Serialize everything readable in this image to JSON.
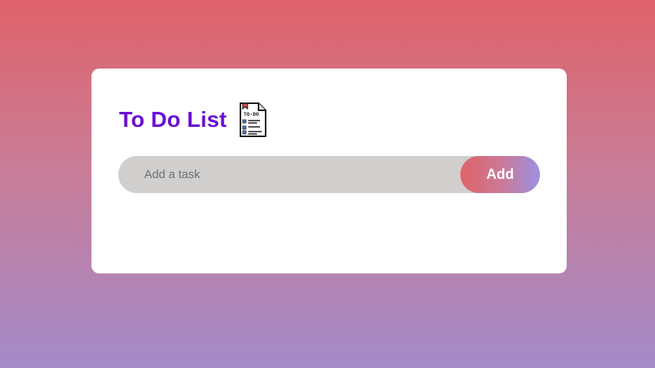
{
  "app": {
    "title": "To Do List",
    "title_icon": "todo-document-icon"
  },
  "task_form": {
    "input_value": "",
    "input_placeholder": "Add a task",
    "add_label": "Add"
  },
  "icon_text": "TO-DO",
  "colors": {
    "background_top": "#e0626a",
    "background_bottom": "#a48bca",
    "title": "#6a0fd4",
    "input_bg": "#d1cece",
    "button_gradient_start": "#e26369",
    "button_gradient_end": "#9a92e4"
  }
}
